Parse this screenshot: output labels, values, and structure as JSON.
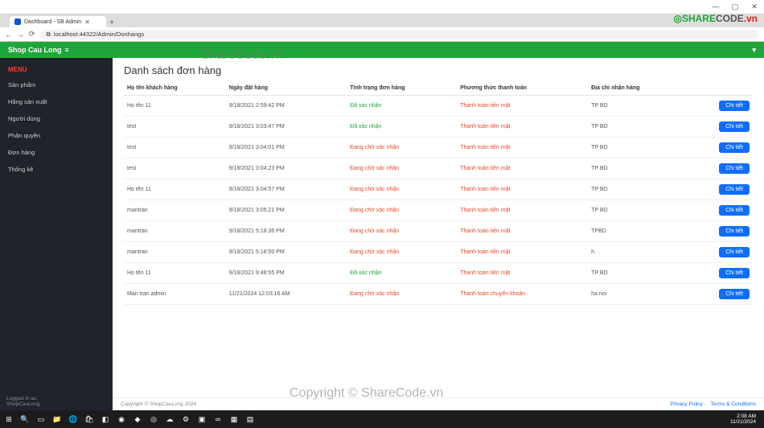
{
  "window": {
    "minimize": "—",
    "maximize": "▢",
    "close": "✕"
  },
  "browser": {
    "tab_title": "Dashboard - SB Admin",
    "new_tab": "+",
    "back": "←",
    "forward": "→",
    "reload": "⟳",
    "secure_icon": "⧉",
    "url": "localhost:44322/Admin/Donhangs"
  },
  "header": {
    "brand": "Shop Cau Long",
    "menu_toggle": "≡",
    "user": "▾"
  },
  "sidebar": {
    "menu_label": "MENU",
    "items": [
      {
        "label": "Sản phẩm"
      },
      {
        "label": "Hãng sản xuất"
      },
      {
        "label": "Người dùng"
      },
      {
        "label": "Phân quyền"
      },
      {
        "label": "Đơn hàng"
      },
      {
        "label": "Thống kê"
      }
    ],
    "footer_line1": "Logged in as:",
    "footer_line2": "ShopCauLong"
  },
  "page": {
    "title": "Danh sách đơn hàng",
    "columns": {
      "name": "Họ tên khách hàng",
      "date": "Ngày đặt hàng",
      "status": "Tình trạng đơn hàng",
      "payment": "Phương thức thanh toán",
      "address": "Địa chỉ nhận hàng",
      "action": ""
    },
    "detail_label": "Chi tiết",
    "rows": [
      {
        "name": "Họ tên 11",
        "date": "9/18/2021 2:59:42 PM",
        "status": "Đã xác nhận",
        "status_class": "status-ok",
        "payment": "Thanh toán tiền mặt",
        "pay_class": "pay-cash",
        "address": "TP BD"
      },
      {
        "name": "test",
        "date": "9/18/2021 3:03:47 PM",
        "status": "Đã xác nhận",
        "status_class": "status-ok",
        "payment": "Thanh toán tiền mặt",
        "pay_class": "pay-cash",
        "address": "TP BD"
      },
      {
        "name": "test",
        "date": "9/18/2021 3:04:01 PM",
        "status": "Đang chờ xác nhận",
        "status_class": "status-wait",
        "payment": "Thanh toán tiền mặt",
        "pay_class": "pay-cash",
        "address": "TP BD"
      },
      {
        "name": "test",
        "date": "9/18/2021 3:04:23 PM",
        "status": "Đang chờ xác nhận",
        "status_class": "status-wait",
        "payment": "Thanh toán tiền mặt",
        "pay_class": "pay-cash",
        "address": "TP BD"
      },
      {
        "name": "Họ tên 11",
        "date": "9/18/2021 3:04:57 PM",
        "status": "Đang chờ xác nhận",
        "status_class": "status-wait",
        "payment": "Thanh toán tiền mặt",
        "pay_class": "pay-cash",
        "address": "TP BD"
      },
      {
        "name": "mantran",
        "date": "9/18/2021 3:05:21 PM",
        "status": "Đang chờ xác nhận",
        "status_class": "status-wait",
        "payment": "Thanh toán tiền mặt",
        "pay_class": "pay-cash",
        "address": "TP BD"
      },
      {
        "name": "mantran",
        "date": "9/18/2021 5:18:36 PM",
        "status": "Đang chờ xác nhận",
        "status_class": "status-wait",
        "payment": "Thanh toán tiền mặt",
        "pay_class": "pay-cash",
        "address": "TPBD"
      },
      {
        "name": "mantran",
        "date": "9/18/2021 5:18:50 PM",
        "status": "Đang chờ xác nhận",
        "status_class": "status-wait",
        "payment": "Thanh toán tiền mặt",
        "pay_class": "pay-cash",
        "address": "h"
      },
      {
        "name": "Họ tên 11",
        "date": "9/18/2021 9:48:55 PM",
        "status": "Đã xác nhận",
        "status_class": "status-ok",
        "payment": "Thanh toán tiền mặt",
        "pay_class": "pay-cash",
        "address": "TP BD"
      },
      {
        "name": "Man tran admin",
        "date": "11/21/2024 12:03:16 AM",
        "status": "Đang chờ xác nhận",
        "status_class": "status-wait",
        "payment": "Thanh toán chuyển khoản",
        "pay_class": "pay-bank",
        "address": "ha noi"
      }
    ]
  },
  "footer": {
    "copyright": "Copyright © ShopCauLong 2024",
    "privacy": "Privacy Policy",
    "terms": "Terms & Conditions",
    "sep": " · "
  },
  "taskbar": {
    "time": "2:08 AM",
    "date": "11/21/2024"
  },
  "watermark": {
    "top": "ShareCode.vn",
    "bottom": "Copyright © ShareCode.vn",
    "logo_green": "SHARE",
    "logo_dark": "CODE",
    "logo_red": ".vn"
  }
}
